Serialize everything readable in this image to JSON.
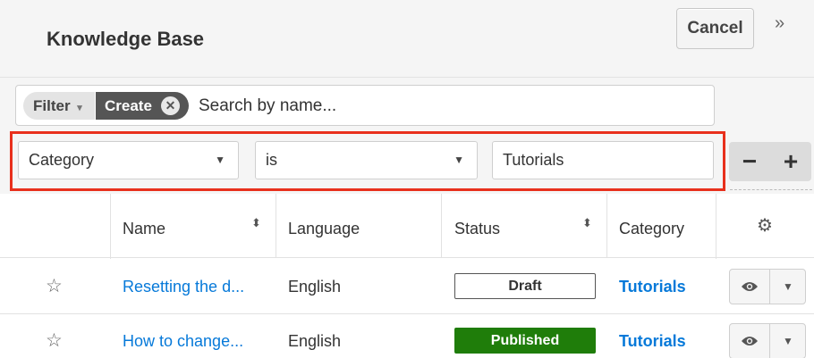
{
  "header": {
    "title": "Knowledge Base",
    "cancel_label": "Cancel",
    "collapse_icon": "»"
  },
  "filter": {
    "filter_label": "Filter",
    "filter_caret": "▾",
    "create_label": "Create",
    "create_remove_icon": "✕",
    "search_placeholder": "Search by name..."
  },
  "rule": {
    "field": "Category",
    "operator": "is",
    "value": "Tutorials",
    "caret": "▼",
    "minus": "−",
    "plus": "+"
  },
  "table": {
    "columns": {
      "name": "Name",
      "language": "Language",
      "status": "Status",
      "category": "Category"
    },
    "sort_icon": "⬍",
    "settings_icon": "⚙",
    "rows": [
      {
        "favorite": "☆",
        "name": "Resetting the d...",
        "language": "English",
        "status": "Draft",
        "category": "Tutorials"
      },
      {
        "favorite": "☆",
        "name": "How to change...",
        "language": "English",
        "status": "Published",
        "category": "Tutorials"
      }
    ],
    "caret": "▼"
  },
  "colors": {
    "link": "#0679d9",
    "published": "#1f7d0a",
    "highlight": "#e8301c"
  }
}
